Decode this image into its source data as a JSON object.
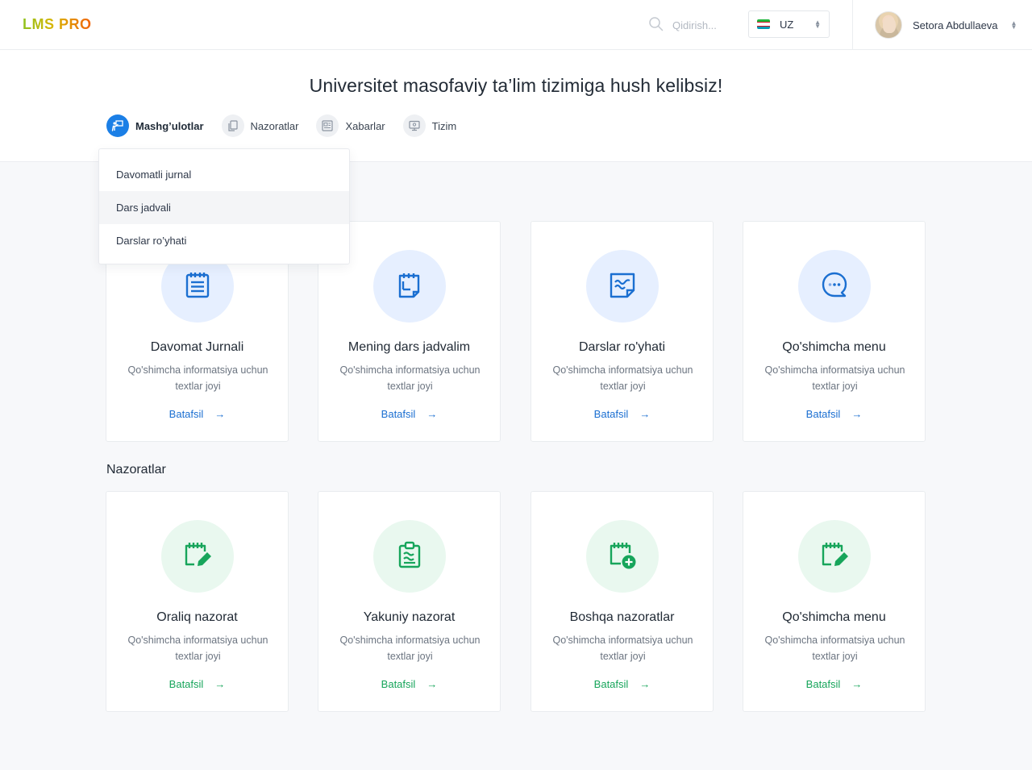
{
  "brand": {
    "logo_text": "LMS PRO"
  },
  "header": {
    "search_placeholder": "Qidirish...",
    "language": {
      "selected": "UZ",
      "flag_colors": [
        "#1eb53a",
        "#ffffff",
        "#0099b5"
      ]
    },
    "user": {
      "name": "Setora Abdullaeva"
    }
  },
  "hero": {
    "title": "Universitet masofaviy ta’lim tizimiga hush kelibsiz!",
    "tabs": [
      {
        "label": "Mashg’ulotlar",
        "icon": "teacher-board-icon",
        "active": true
      },
      {
        "label": "Nazoratlar",
        "icon": "document-copy-icon",
        "active": false
      },
      {
        "label": "Xabarlar",
        "icon": "newspaper-icon",
        "active": false
      },
      {
        "label": "Tizim",
        "icon": "monitor-icon",
        "active": false
      }
    ]
  },
  "dropdown": {
    "items": [
      {
        "label": "Davomatli jurnal"
      },
      {
        "label": "Dars jadvali",
        "hovered": true
      },
      {
        "label": "Darslar ro’yhati"
      }
    ]
  },
  "sections": {
    "nazoratlar_title": "Nazoratlar"
  },
  "cards_top": [
    {
      "title": "Davomat Jurnali",
      "desc": "Qo'shimcha informatsiya uchun textlar joyi",
      "link": "Batafsil",
      "icon": "notepad-list-icon"
    },
    {
      "title": "Mening dars jadvalim",
      "desc": "Qo'shimcha informatsiya uchun textlar joyi",
      "link": "Batafsil",
      "icon": "calendar-notes-icon"
    },
    {
      "title": "Darslar ro'yhati",
      "desc": "Qo'shimcha informatsiya uchun textlar joyi",
      "link": "Batafsil",
      "icon": "wave-note-icon"
    },
    {
      "title": "Qo'shimcha menu",
      "desc": "Qo'shimcha informatsiya uchun textlar joyi",
      "link": "Batafsil",
      "icon": "chat-bubble-icon"
    }
  ],
  "cards_bottom": [
    {
      "title": "Oraliq nazorat",
      "desc": "Qo'shimcha informatsiya uchun textlar joyi",
      "link": "Batafsil",
      "icon": "calendar-edit-icon"
    },
    {
      "title": "Yakuniy nazorat",
      "desc": "Qo'shimcha informatsiya uchun textlar joyi",
      "link": "Batafsil",
      "icon": "clipboard-icon"
    },
    {
      "title": "Boshqa nazoratlar",
      "desc": "Qo'shimcha informatsiya uchun textlar joyi",
      "link": "Batafsil",
      "icon": "calendar-add-icon"
    },
    {
      "title": "Qo'shimcha menu",
      "desc": "Qo'shimcha informatsiya uchun textlar joyi",
      "link": "Batafsil",
      "icon": "calendar-edit-icon"
    }
  ],
  "colors": {
    "accent_blue": "#1b7fe6",
    "accent_green": "#17a55b",
    "link_blue": "#1b6fd1"
  },
  "link_arrow": "→"
}
